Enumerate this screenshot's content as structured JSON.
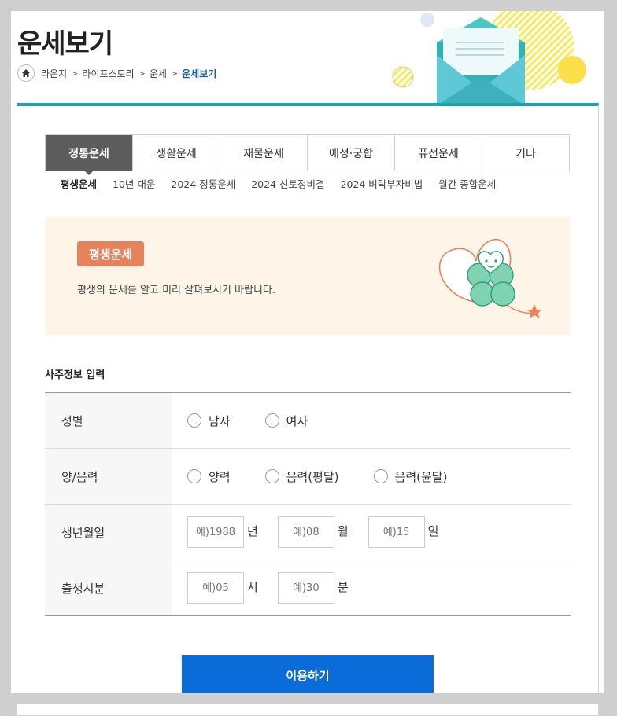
{
  "header": {
    "title": "운세보기",
    "breadcrumb": [
      "라운지",
      "라이프스토리",
      "운세"
    ],
    "breadcrumb_current": "운세보기"
  },
  "tabs": [
    {
      "label": "정통운세",
      "active": true
    },
    {
      "label": "생활운세"
    },
    {
      "label": "재물운세"
    },
    {
      "label": "애정·궁합"
    },
    {
      "label": "퓨전운세"
    },
    {
      "label": "기타"
    }
  ],
  "subtabs": [
    {
      "label": "평생운세",
      "active": true
    },
    {
      "label": "10년 대운"
    },
    {
      "label": "2024 정통운세"
    },
    {
      "label": "2024 신토정비결"
    },
    {
      "label": "2024 벼락부자비법"
    },
    {
      "label": "월간 종합운세"
    }
  ],
  "intro": {
    "badge": "평생운세",
    "description": "평생의 운세를 알고 미리 살펴보시기 바랍니다."
  },
  "form": {
    "section_title": "사주정보 입력",
    "gender": {
      "label": "성별",
      "options": [
        "남자",
        "여자"
      ]
    },
    "calendar": {
      "label": "양/음력",
      "options": [
        "양력",
        "음력(평달)",
        "음력(윤달)"
      ]
    },
    "birthdate": {
      "label": "생년월일",
      "year_placeholder": "예)1988",
      "year_unit": "년",
      "month_placeholder": "예)08",
      "month_unit": "월",
      "day_placeholder": "예)15",
      "day_unit": "일"
    },
    "birthtime": {
      "label": "출생시분",
      "hour_placeholder": "예)05",
      "hour_unit": "시",
      "minute_placeholder": "예)30",
      "minute_unit": "분"
    }
  },
  "submit_label": "이용하기",
  "colors": {
    "accent_teal": "#1ea3a8",
    "tab_active": "#5c5c5c",
    "badge": "#e8825a",
    "intro_bg": "#fff4e8",
    "submit": "#0a6cd9",
    "breadcrumb_current": "#1a5fa8"
  },
  "icons": {
    "home": "home-icon",
    "banner": "envelope-illustration",
    "intro": "clover-heart-illustration"
  }
}
